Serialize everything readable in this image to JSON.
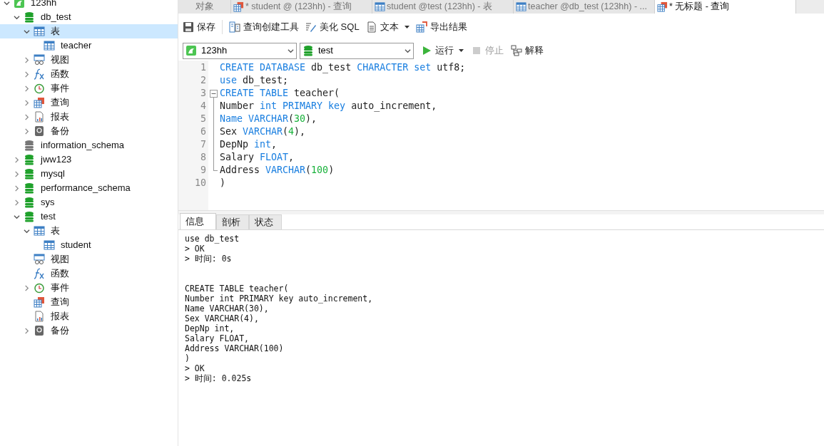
{
  "sidebar": {
    "tree": [
      {
        "label": "123hh",
        "kind": "connection",
        "expanded": true,
        "selected": false,
        "children": [
          {
            "label": "db_test",
            "kind": "database",
            "expanded": true,
            "selected": false,
            "children": [
              {
                "label": "表",
                "kind": "tables",
                "expanded": true,
                "selected": true,
                "children": [
                  {
                    "label": "teacher",
                    "kind": "table",
                    "selected": false
                  }
                ]
              },
              {
                "label": "视图",
                "kind": "views",
                "expanded": false,
                "selected": false
              },
              {
                "label": "函数",
                "kind": "functions",
                "expanded": false,
                "selected": false
              },
              {
                "label": "事件",
                "kind": "events",
                "expanded": false,
                "selected": false
              },
              {
                "label": "查询",
                "kind": "queries",
                "expanded": false,
                "selected": false
              },
              {
                "label": "报表",
                "kind": "reports",
                "expanded": false,
                "selected": false
              },
              {
                "label": "备份",
                "kind": "backups",
                "expanded": false,
                "selected": false
              }
            ]
          },
          {
            "label": "information_schema",
            "kind": "database-closed",
            "selected": false
          },
          {
            "label": "jww123",
            "kind": "database",
            "expanded": false,
            "selected": false
          },
          {
            "label": "mysql",
            "kind": "database",
            "expanded": false,
            "selected": false
          },
          {
            "label": "performance_schema",
            "kind": "database",
            "expanded": false,
            "selected": false
          },
          {
            "label": "sys",
            "kind": "database",
            "expanded": false,
            "selected": false
          },
          {
            "label": "test",
            "kind": "database",
            "expanded": true,
            "selected": false,
            "children": [
              {
                "label": "表",
                "kind": "tables",
                "expanded": true,
                "selected": false,
                "children": [
                  {
                    "label": "student",
                    "kind": "table",
                    "selected": false
                  }
                ]
              },
              {
                "label": "视图",
                "kind": "views",
                "selected": false
              },
              {
                "label": "函数",
                "kind": "functions",
                "selected": false
              },
              {
                "label": "事件",
                "kind": "events",
                "expanded": false,
                "selected": false
              },
              {
                "label": "查询",
                "kind": "queries",
                "selected": false
              },
              {
                "label": "报表",
                "kind": "reports",
                "selected": false
              },
              {
                "label": "备份",
                "kind": "backups",
                "expanded": false,
                "selected": false
              }
            ]
          }
        ]
      }
    ]
  },
  "tabs": [
    {
      "label": "对象",
      "kind": "plain",
      "selected": false
    },
    {
      "label": "* student @ (123hh) - 查询",
      "kind": "query",
      "selected": false
    },
    {
      "label": "student @test (123hh) - 表",
      "kind": "table",
      "selected": false
    },
    {
      "label": "teacher @db_test (123hh) - ...",
      "kind": "table",
      "selected": false
    },
    {
      "label": "* 无标题 - 查询",
      "kind": "query",
      "selected": true
    }
  ],
  "toolbar": [
    {
      "label": "保存",
      "kind": "save",
      "dropdown": false
    },
    {
      "label": "查询创建工具",
      "kind": "builder",
      "dropdown": false
    },
    {
      "label": "美化 SQL",
      "kind": "beautify",
      "dropdown": false
    },
    {
      "label": "文本",
      "kind": "text",
      "dropdown": true
    },
    {
      "label": "导出结果",
      "kind": "export",
      "dropdown": false
    }
  ],
  "connection_select": {
    "value": "123hh"
  },
  "database_select": {
    "value": "test"
  },
  "run_controls": [
    {
      "label": "运行",
      "kind": "run",
      "dropdown": true,
      "disabled": false
    },
    {
      "label": "停止",
      "kind": "stop",
      "dropdown": false,
      "disabled": true
    },
    {
      "label": "解释",
      "kind": "explain",
      "dropdown": false,
      "disabled": false
    }
  ],
  "editor": {
    "lines": [
      {
        "number": "1",
        "kind": "plain",
        "tokens": [
          {
            "text": "CREATE DATABASE",
            "kind": "keyword"
          },
          {
            "text": " db_test ",
            "kind": "plain"
          },
          {
            "text": "CHARACTER set",
            "kind": "keyword"
          },
          {
            "text": " utf8;",
            "kind": "plain"
          }
        ]
      },
      {
        "number": "2",
        "kind": "plain",
        "tokens": [
          {
            "text": "use",
            "kind": "keyword"
          },
          {
            "text": " db_test;",
            "kind": "plain"
          }
        ]
      },
      {
        "number": "3",
        "kind": "fold-start",
        "tokens": [
          {
            "text": "CREATE TABLE",
            "kind": "keyword"
          },
          {
            "text": " teacher(",
            "kind": "plain"
          }
        ]
      },
      {
        "number": "4",
        "kind": "fold-body",
        "tokens": [
          {
            "text": "Number ",
            "kind": "plain"
          },
          {
            "text": "int PRIMARY key",
            "kind": "keyword"
          },
          {
            "text": " auto_increment,",
            "kind": "plain"
          }
        ]
      },
      {
        "number": "5",
        "kind": "fold-body",
        "tokens": [
          {
            "text": "Name VARCHAR",
            "kind": "keyword"
          },
          {
            "text": "(",
            "kind": "plain"
          },
          {
            "text": "30",
            "kind": "number"
          },
          {
            "text": "),",
            "kind": "plain"
          }
        ]
      },
      {
        "number": "6",
        "kind": "fold-body",
        "tokens": [
          {
            "text": "Sex ",
            "kind": "plain"
          },
          {
            "text": "VARCHAR",
            "kind": "keyword"
          },
          {
            "text": "(",
            "kind": "plain"
          },
          {
            "text": "4",
            "kind": "number"
          },
          {
            "text": "),",
            "kind": "plain"
          }
        ]
      },
      {
        "number": "7",
        "kind": "fold-body",
        "tokens": [
          {
            "text": "DepNp ",
            "kind": "plain"
          },
          {
            "text": "int",
            "kind": "keyword"
          },
          {
            "text": ",",
            "kind": "plain"
          }
        ]
      },
      {
        "number": "8",
        "kind": "fold-body",
        "tokens": [
          {
            "text": "Salary ",
            "kind": "plain"
          },
          {
            "text": "FLOAT",
            "kind": "keyword"
          },
          {
            "text": ",",
            "kind": "plain"
          }
        ]
      },
      {
        "number": "9",
        "kind": "fold-end",
        "tokens": [
          {
            "text": "Address ",
            "kind": "plain"
          },
          {
            "text": "VARCHAR",
            "kind": "keyword"
          },
          {
            "text": "(",
            "kind": "plain"
          },
          {
            "text": "100",
            "kind": "number"
          },
          {
            "text": ")",
            "kind": "plain"
          }
        ]
      },
      {
        "number": "10",
        "kind": "plain",
        "tokens": [
          {
            "text": ")",
            "kind": "plain"
          }
        ]
      }
    ]
  },
  "result_tabs": [
    {
      "label": "信息",
      "selected": true
    },
    {
      "label": "剖析",
      "selected": false
    },
    {
      "label": "状态",
      "selected": false
    }
  ],
  "message_blocks": [
    {
      "lines": [
        "use db_test",
        "> OK",
        "> 时间: 0s"
      ]
    },
    {
      "lines": [
        "CREATE TABLE teacher(",
        "Number int PRIMARY key auto_increment,",
        "Name VARCHAR(30),",
        "Sex VARCHAR(4),",
        "DepNp int,",
        "Salary FLOAT,",
        "Address VARCHAR(100)",
        ")",
        "> OK",
        "> 时间: 0.025s"
      ]
    }
  ]
}
